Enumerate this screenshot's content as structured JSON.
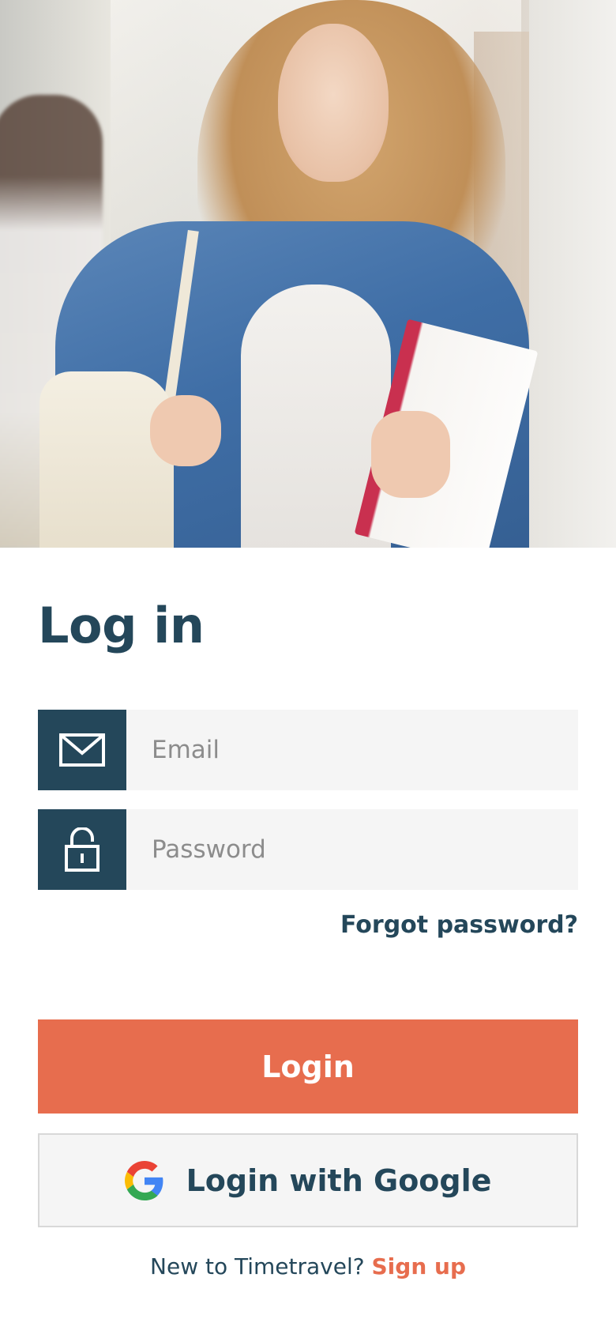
{
  "hero": {
    "image": "student-with-notebook-photo"
  },
  "login": {
    "title": "Log in",
    "email": {
      "placeholder": "Email",
      "value": "",
      "icon": "mail-icon"
    },
    "password": {
      "placeholder": "Password",
      "value": "",
      "icon": "lock-icon"
    },
    "forgot_label": "Forgot password?",
    "login_label": "Login",
    "google_label": "Login with Google",
    "signup_prompt": "New to Timetravel?",
    "signup_label": "Sign up"
  },
  "colors": {
    "primary": "#24475a",
    "accent": "#e76d4e",
    "field_bg": "#f5f5f5"
  }
}
